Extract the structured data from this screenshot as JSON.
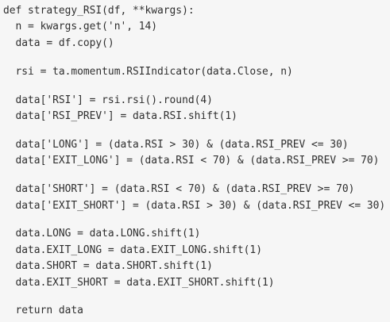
{
  "code": {
    "lines": [
      "def strategy_RSI(df, **kwargs):",
      "  n = kwargs.get('n', 14)",
      "  data = df.copy()",
      "",
      "  rsi = ta.momentum.RSIIndicator(data.Close, n)",
      "",
      "  data['RSI'] = rsi.rsi().round(4)",
      "  data['RSI_PREV'] = data.RSI.shift(1)",
      "",
      "  data['LONG'] = (data.RSI > 30) & (data.RSI_PREV <= 30)",
      "  data['EXIT_LONG'] = (data.RSI < 70) & (data.RSI_PREV >= 70)",
      "",
      "  data['SHORT'] = (data.RSI < 70) & (data.RSI_PREV >= 70)",
      "  data['EXIT_SHORT'] = (data.RSI > 30) & (data.RSI_PREV <= 30)",
      "",
      "  data.LONG = data.LONG.shift(1)",
      "  data.EXIT_LONG = data.EXIT_LONG.shift(1)",
      "  data.SHORT = data.SHORT.shift(1)",
      "  data.EXIT_SHORT = data.EXIT_SHORT.shift(1)",
      "",
      "  return data"
    ]
  }
}
